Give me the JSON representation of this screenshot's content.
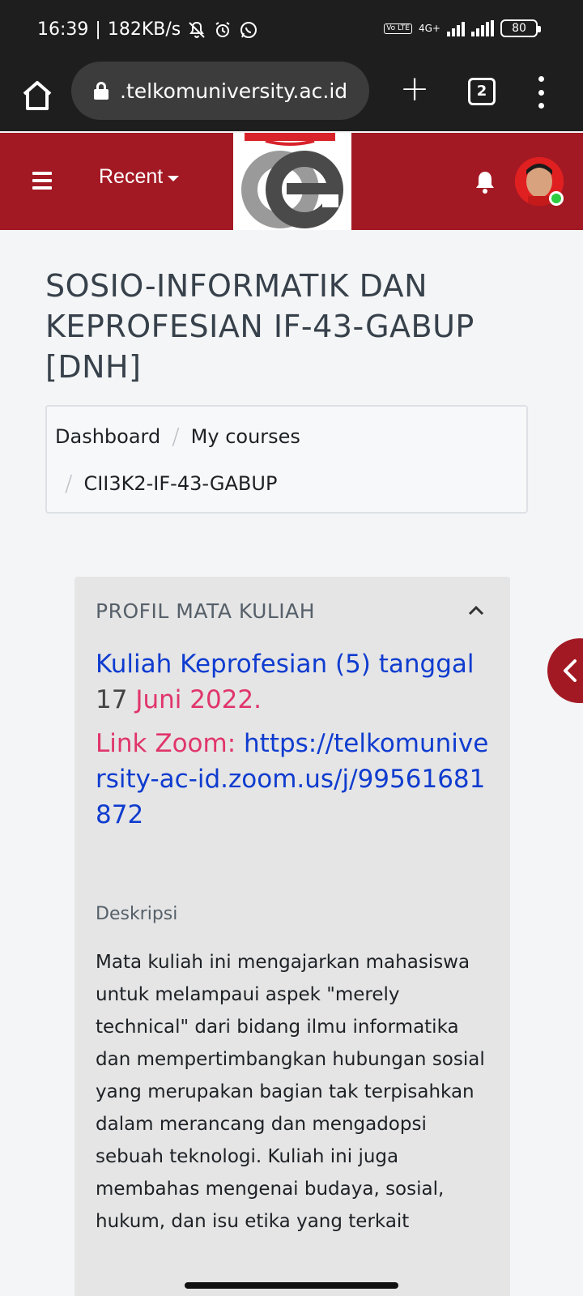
{
  "status_bar": {
    "time": "16:39",
    "speed": "182KB/s",
    "network": "4G+",
    "lte_label": "Vo LTE",
    "battery": "80"
  },
  "browser": {
    "url": ".telkomuniversity.ac.id",
    "tab_count": "2"
  },
  "header": {
    "recent_label": "Recent",
    "brand_color": "#a31923"
  },
  "page": {
    "title": "SOSIO-INFORMATIK DAN KEPROFESIAN IF-43-GABUP [DNH]",
    "breadcrumb": [
      "Dashboard",
      "My courses",
      "CII3K2-IF-43-GABUP"
    ]
  },
  "section": {
    "header": "PROFIL MATA KULIAH",
    "info_part1": "Kuliah Keprofesian (5) tanggal",
    "info_day": "17",
    "info_date": "Juni 2022.",
    "zoom_label": "Link Zoom:",
    "zoom_url": "https://telkomuniversity-ac-id.zoom.us/j/99561681872",
    "desc_label": "Deskripsi",
    "desc_text": "Mata kuliah ini mengajarkan mahasiswa untuk melampaui aspek \"merely technical\" dari bidang ilmu informatika dan mempertimbangkan hubungan sosial yang merupakan bagian tak terpisahkan dalam merancang dan mengadopsi sebuah teknologi.  Kuliah ini juga membahas mengenai budaya, sosial, hukum, dan isu etika yang terkait"
  }
}
